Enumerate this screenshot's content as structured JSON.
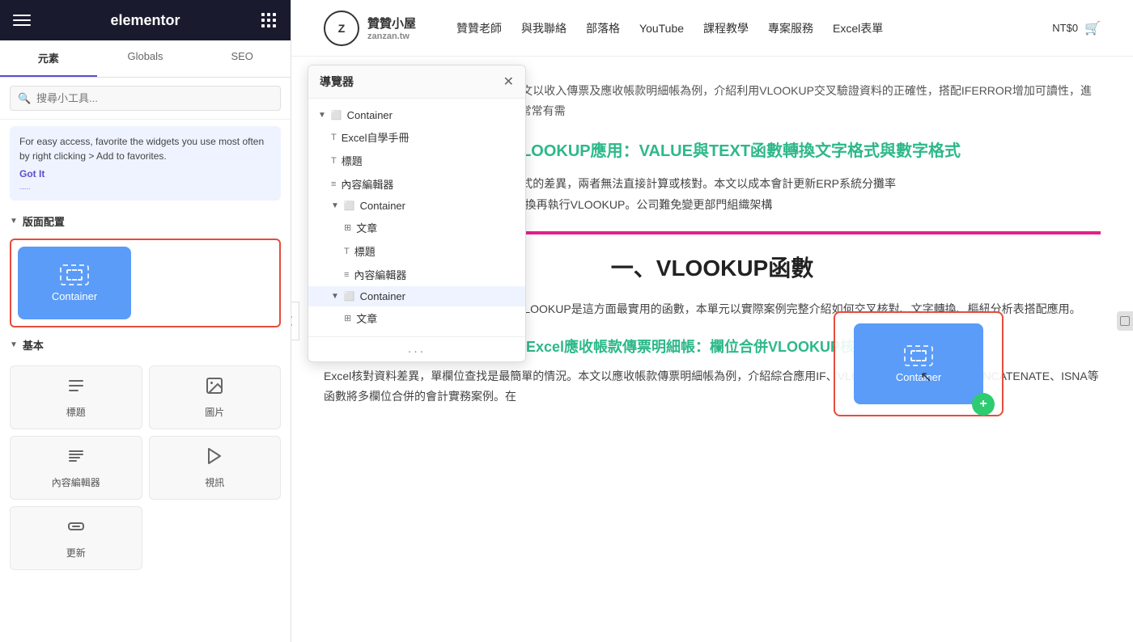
{
  "sidebar": {
    "title": "elementor",
    "tabs": [
      {
        "id": "elements",
        "label": "元素",
        "active": true
      },
      {
        "id": "globals",
        "label": "Globals",
        "active": false
      },
      {
        "id": "seo",
        "label": "SEO",
        "active": false
      }
    ],
    "search_placeholder": "搜尋小工具...",
    "tip": {
      "text": "For easy access, favorite the widgets you use most often by right clicking > Add to favorites.",
      "got_it": "Got It",
      "dots": "......"
    },
    "panel_config_label": "版面配置",
    "container_label": "Container",
    "basic_section_label": "基本",
    "widgets": [
      {
        "id": "heading",
        "label": "標題"
      },
      {
        "id": "image",
        "label": "圖片"
      },
      {
        "id": "content-editor",
        "label": "內容編輯器"
      },
      {
        "id": "video",
        "label": "視訊"
      },
      {
        "id": "button",
        "label": "更新"
      }
    ]
  },
  "navigator": {
    "title": "導覽器",
    "items": [
      {
        "level": 0,
        "type": "container",
        "label": "Container",
        "has_arrow": true
      },
      {
        "level": 1,
        "type": "text",
        "label": "Excel自學手冊"
      },
      {
        "level": 1,
        "type": "text",
        "label": "標題"
      },
      {
        "level": 1,
        "type": "text",
        "label": "內容編輯器"
      },
      {
        "level": 1,
        "type": "container",
        "label": "Container",
        "has_arrow": true
      },
      {
        "level": 2,
        "type": "article",
        "label": "文章"
      },
      {
        "level": 2,
        "type": "text",
        "label": "標題"
      },
      {
        "level": 2,
        "type": "text",
        "label": "內容編輯器"
      },
      {
        "level": 1,
        "type": "container",
        "label": "Container",
        "has_arrow": true,
        "highlighted": true
      },
      {
        "level": 2,
        "type": "article",
        "label": "文章"
      }
    ],
    "more": "..."
  },
  "site": {
    "logo_letter": "Z",
    "logo_text": "贊贊小屋",
    "logo_sub": "zanzan.tw",
    "nav_items": [
      "贊贊老師",
      "與我聯絡",
      "部落格",
      "YouTube",
      "課程教學",
      "專案服務",
      "Excel表單"
    ],
    "price": "NT$0"
  },
  "content": {
    "excerpt": "Excel經常要核對兩份報表差異情形，本文以收入傳票及應收帳款明細帳為例，介紹利用VLOOKUP交叉驗證資料的正確性，搭配IFERROR增加可讀性，進而活用IF及LEFT函數。從事會計工作，常常有需",
    "article_title": "Excel VLOOKUP應用：VALUE與TEXT函數轉換文字格式與數字格式",
    "article_body": "Excel函數公式要注意文字格式和數字格式的差異，兩者無法直接計算或核對。本文以成本會計更新ERP系統分攤率為例，介紹如何以VALUE和TEXT函數轉換再執行VLOOKUP。公司難免變更部門組織架構",
    "container_label": "Container",
    "section_title": "一、VLOOKUP函數",
    "vlookup_intro": "工作中常常需要核對數字和分析報表，VLOOKUP是這方面最實用的函數，本單元以實際案例完整介紹如何交叉核對、文字轉換、樞紐分析表搭配應用。",
    "green_title": "Excel應收帳款傳票明細帳：欄位合併VLOOKUP核對差異",
    "bottom_excerpt": "Excel核對資料差異，單欄位查找是最簡單的情況。本文以應收帳款傳票明細帳為例，介紹綜合應用IF、VLOOKUP、IFERROR、CONCATENATE、ISNA等函數將多欄位合併的會計實務案例。在"
  }
}
